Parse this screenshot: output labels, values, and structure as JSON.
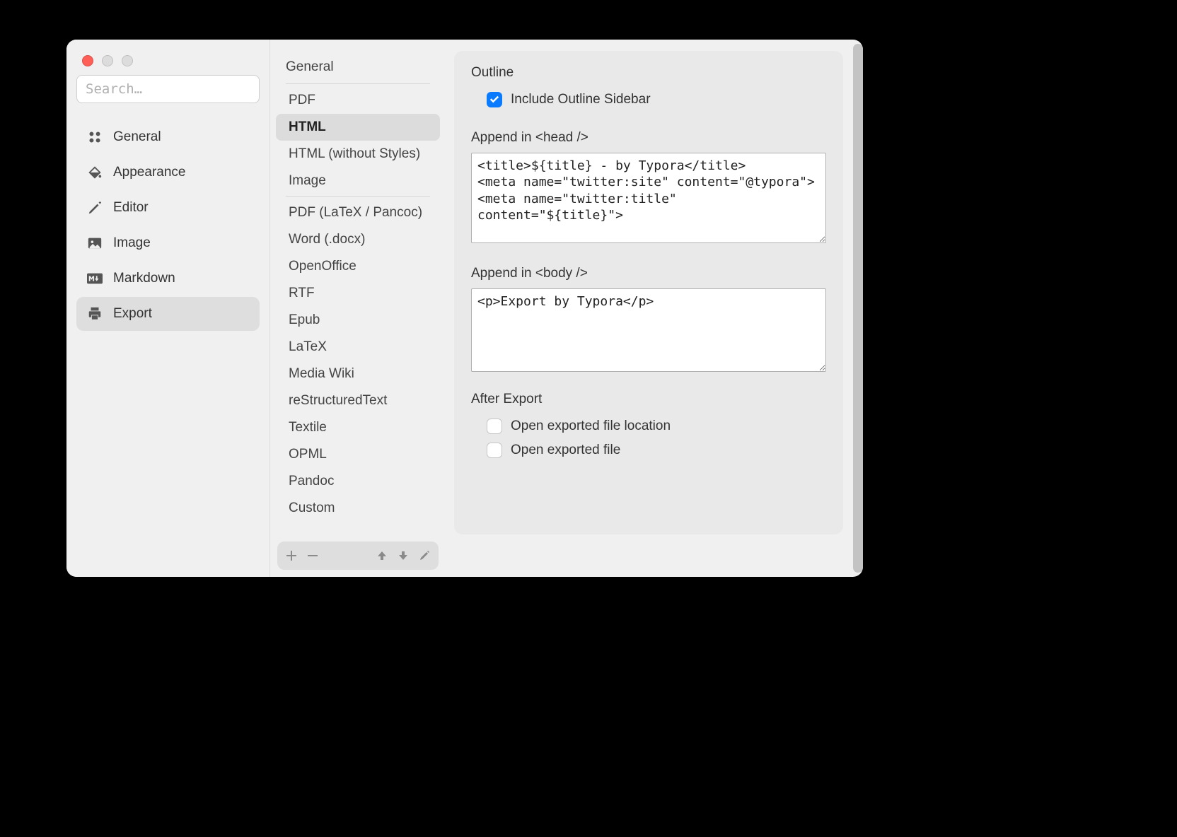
{
  "search": {
    "placeholder": "Search…"
  },
  "sidebar": {
    "items": [
      {
        "label": "General"
      },
      {
        "label": "Appearance"
      },
      {
        "label": "Editor"
      },
      {
        "label": "Image"
      },
      {
        "label": "Markdown"
      },
      {
        "label": "Export"
      }
    ]
  },
  "middle": {
    "header": "General",
    "group1": [
      {
        "label": "PDF"
      },
      {
        "label": "HTML"
      },
      {
        "label": "HTML (without Styles)"
      },
      {
        "label": "Image"
      }
    ],
    "group2": [
      {
        "label": "PDF (LaTeX / Pancoc)"
      },
      {
        "label": "Word (.docx)"
      },
      {
        "label": "OpenOffice"
      },
      {
        "label": "RTF"
      },
      {
        "label": "Epub"
      },
      {
        "label": "LaTeX"
      },
      {
        "label": "Media Wiki"
      },
      {
        "label": "reStructuredText"
      },
      {
        "label": "Textile"
      },
      {
        "label": "OPML"
      },
      {
        "label": "Pandoc"
      },
      {
        "label": "Custom"
      }
    ]
  },
  "panel": {
    "outline_title": "Outline",
    "include_outline_label": "Include Outline Sidebar",
    "append_head_label": "Append in <head />",
    "append_head_value": "<title>${title} - by Typora</title>\n<meta name=\"twitter:site\" content=\"@typora\">\n<meta name=\"twitter:title\" content=\"${title}\">",
    "append_body_label": "Append in <body />",
    "append_body_value": "<p>Export by Typora</p>",
    "after_export_title": "After Export",
    "open_location_label": "Open exported file location",
    "open_file_label": "Open exported file"
  }
}
